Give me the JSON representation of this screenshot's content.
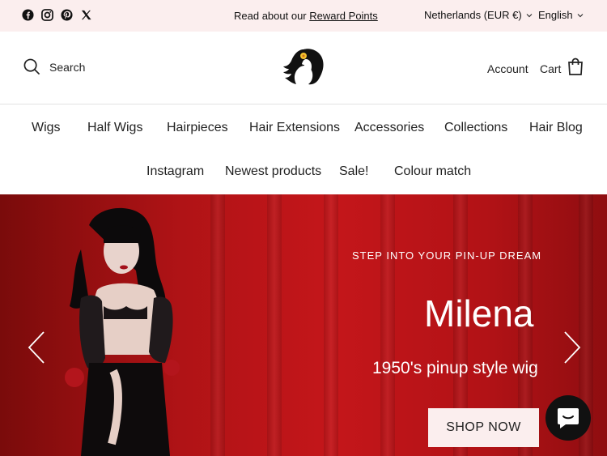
{
  "topbar": {
    "social_icons": [
      "facebook-icon",
      "instagram-icon",
      "pinterest-icon",
      "x-icon"
    ],
    "announcement_prefix": "Read about our ",
    "announcement_link": "Reward Points",
    "country": "Netherlands (EUR €)",
    "language": "English"
  },
  "header": {
    "search_label": "Search",
    "account_label": "Account",
    "cart_label": "Cart"
  },
  "nav": {
    "row1": [
      "Wigs",
      "Half Wigs",
      "Hairpieces",
      "Hair Extensions",
      "Accessories",
      "Collections",
      "Hair Blog"
    ],
    "row2": [
      "Instagram",
      "Newest products",
      "Sale!",
      "Colour match"
    ]
  },
  "hero": {
    "eyebrow": "STEP INTO YOUR PIN-UP DREAM",
    "title": "Milena",
    "subtitle": "1950's pinup style wig",
    "button": "SHOP NOW"
  },
  "colors": {
    "topbar_bg": "#fbeeee",
    "hero_red": "#c4161a",
    "button_bg": "#fbeeee"
  }
}
